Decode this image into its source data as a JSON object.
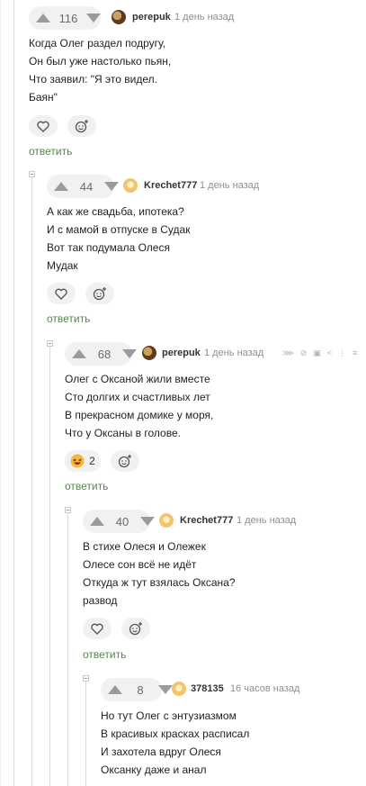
{
  "accent_color": "#4a8f3c",
  "comments": [
    {
      "votes": "116",
      "author": "perepuk",
      "time": "1 день назад",
      "lines": [
        "Когда Олег раздел подругу,",
        "Он был уже настолько пьян,",
        "Что заявил: \"Я это видел.",
        "Баян\""
      ],
      "reply": "ответить"
    },
    {
      "votes": "44",
      "author": "Krechet777",
      "time": "1 день назад",
      "lines": [
        "А как же свадьба, ипотека?",
        "И с мамой в отпуске в Судак",
        "Вот так подумала Олеся",
        "Мудак"
      ],
      "reply": "ответить"
    },
    {
      "votes": "68",
      "author": "perepuk",
      "time": "1 день назад",
      "lines": [
        "Олег с Оксаной жили вместе",
        "Сто долгих и счастливых лет",
        "В прекрасном домике у моря,",
        "Что у Оксаны в голове."
      ],
      "reaction_count": "2",
      "reply": "ответить"
    },
    {
      "votes": "40",
      "author": "Krechet777",
      "time": "1 день назад",
      "lines": [
        "В стихе Олеся и Олежек",
        "Олесе сон всё не идёт",
        "Откуда ж тут взялась Оксана?",
        "развод"
      ],
      "reply": "ответить"
    },
    {
      "votes": "8",
      "author": "378135",
      "time": "16 часов назад",
      "lines": [
        "Но тут Олег с энтузиазмом",
        "В красивых красках расписал",
        "И захотела вдруг Олеся",
        "Оксанку даже и анал"
      ]
    }
  ]
}
